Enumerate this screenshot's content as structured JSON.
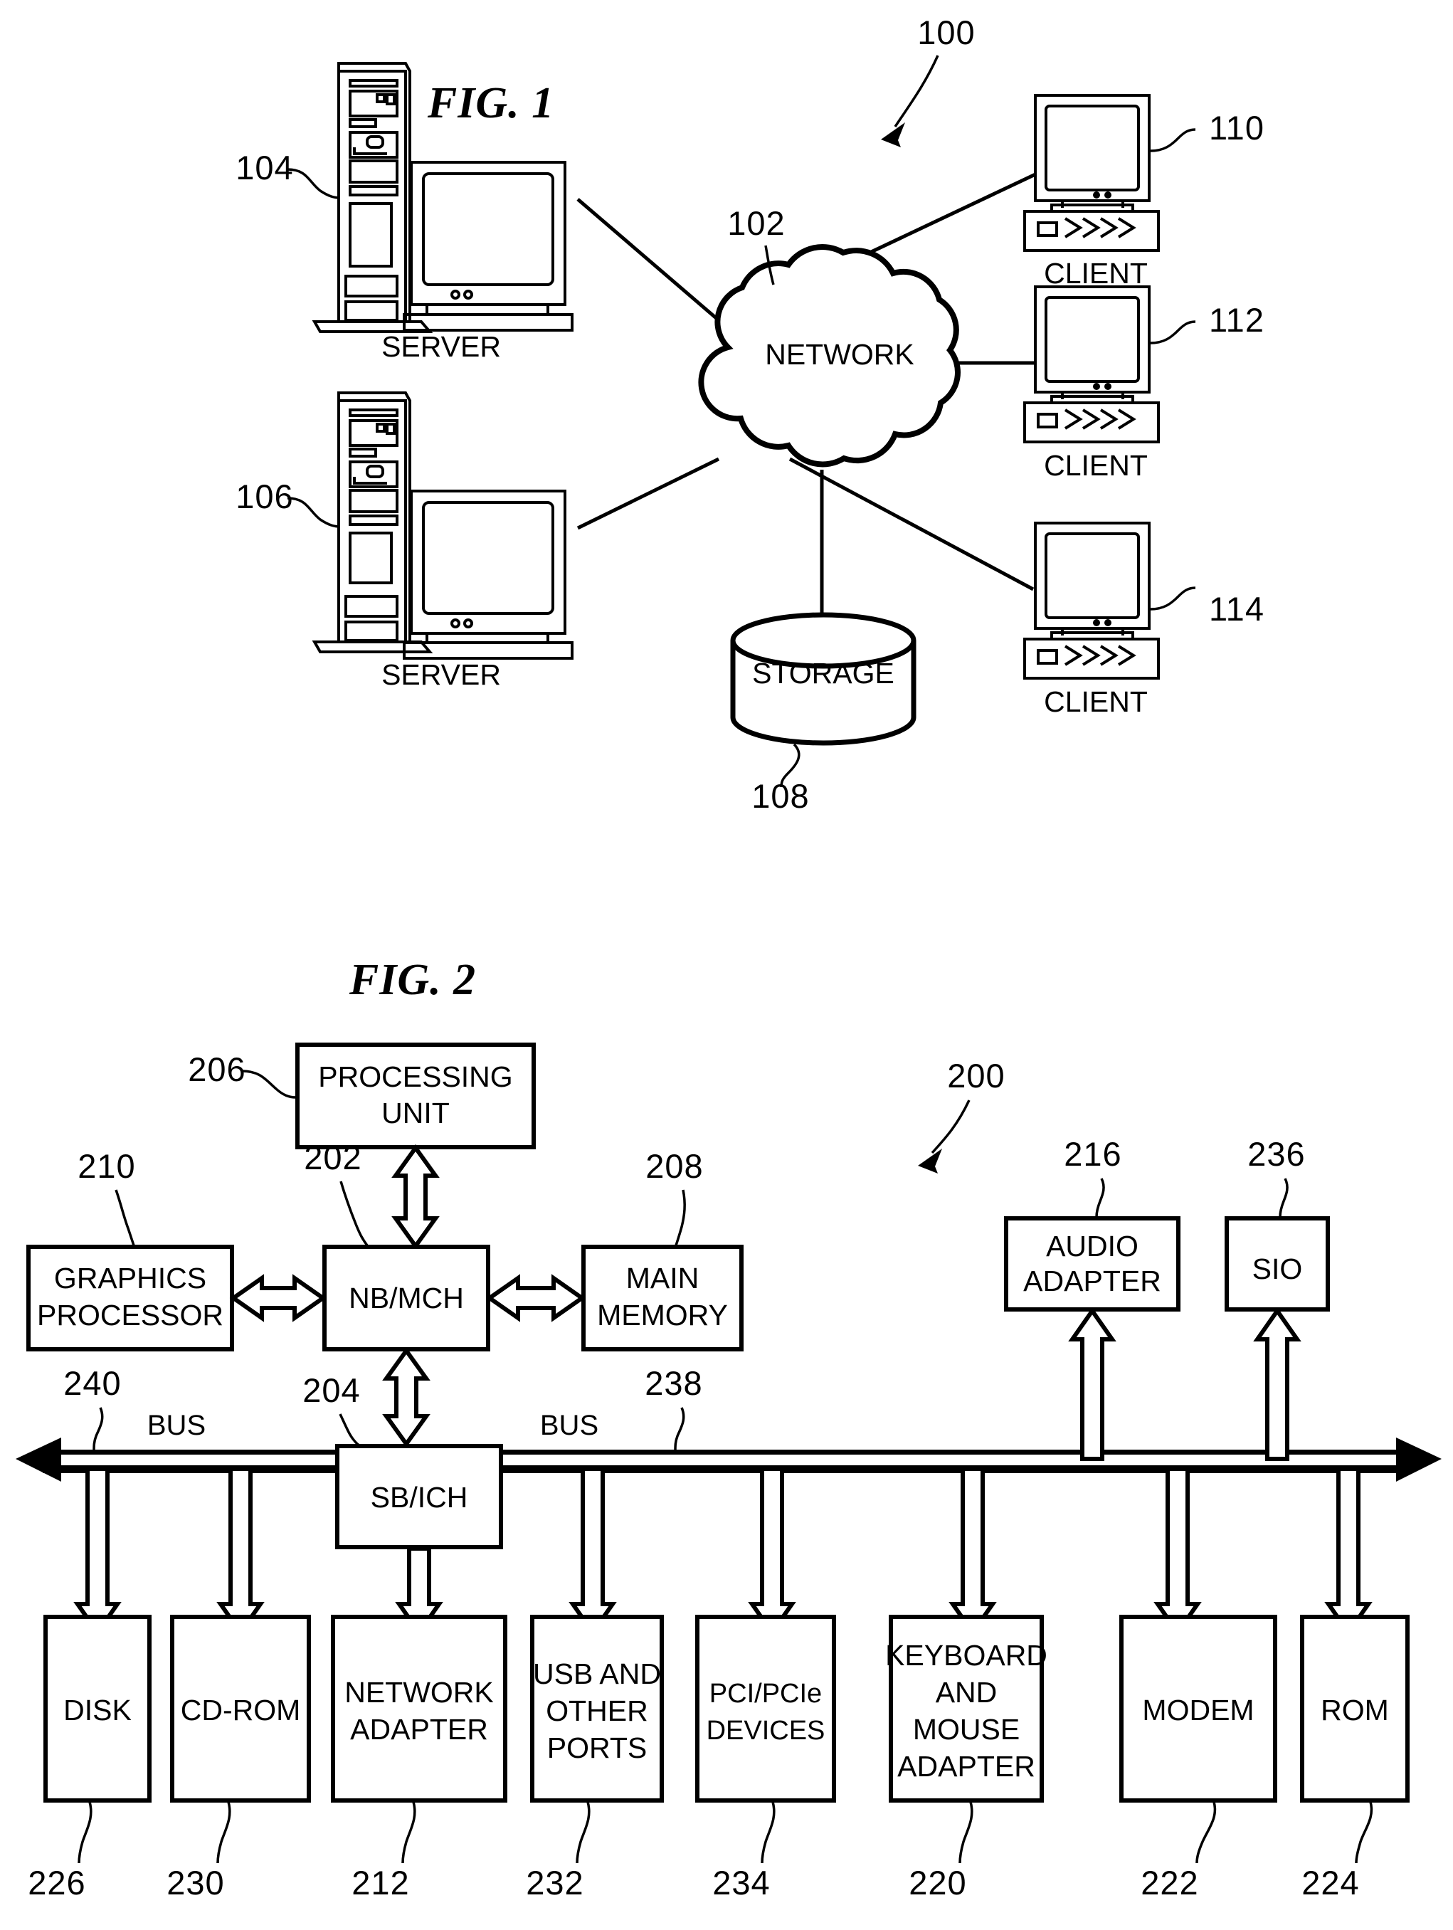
{
  "figures": [
    {
      "id": "fig1",
      "title": "FIG. 1",
      "system_ref": "100",
      "nodes": {
        "server_top": {
          "label": "SERVER",
          "ref": "104"
        },
        "server_bottom": {
          "label": "SERVER",
          "ref": "106"
        },
        "network": {
          "label": "NETWORK",
          "ref": "102"
        },
        "storage": {
          "label": "STORAGE",
          "ref": "108"
        },
        "client_1": {
          "label": "CLIENT",
          "ref": "110"
        },
        "client_2": {
          "label": "CLIENT",
          "ref": "112"
        },
        "client_3": {
          "label": "CLIENT",
          "ref": "114"
        }
      }
    },
    {
      "id": "fig2",
      "title": "FIG. 2",
      "system_ref": "200",
      "nodes": {
        "processing_unit": {
          "label_line1": "PROCESSING",
          "label_line2": "UNIT",
          "ref": "206"
        },
        "nb_mch": {
          "label": "NB/MCH",
          "ref": "202"
        },
        "graphics_processor": {
          "label_line1": "GRAPHICS",
          "label_line2": "PROCESSOR",
          "ref": "210"
        },
        "main_memory": {
          "label_line1": "MAIN",
          "label_line2": "MEMORY",
          "ref": "208"
        },
        "audio_adapter": {
          "label_line1": "AUDIO",
          "label_line2": "ADAPTER",
          "ref": "216"
        },
        "sio": {
          "label": "SIO",
          "ref": "236"
        },
        "sb_ich": {
          "label": "SB/ICH",
          "ref": "204"
        },
        "bus_left": {
          "label": "BUS",
          "ref": "240"
        },
        "bus_right": {
          "label": "BUS",
          "ref": "238"
        },
        "disk": {
          "label": "DISK",
          "ref": "226"
        },
        "cdrom": {
          "label": "CD-ROM",
          "ref": "230"
        },
        "network_adapter": {
          "label_line1": "NETWORK",
          "label_line2": "ADAPTER",
          "ref": "212"
        },
        "usb_ports": {
          "label_line1": "USB AND",
          "label_line2": "OTHER",
          "label_line3": "PORTS",
          "ref": "232"
        },
        "pci_devices": {
          "label_line1": "PCI/PCIe",
          "label_line2": "DEVICES",
          "ref": "234"
        },
        "keyboard_mouse": {
          "label_line1": "KEYBOARD",
          "label_line2": "AND",
          "label_line3": "MOUSE",
          "label_line4": "ADAPTER",
          "ref": "220"
        },
        "modem": {
          "label": "MODEM",
          "ref": "222"
        },
        "rom": {
          "label": "ROM",
          "ref": "224"
        }
      }
    }
  ]
}
